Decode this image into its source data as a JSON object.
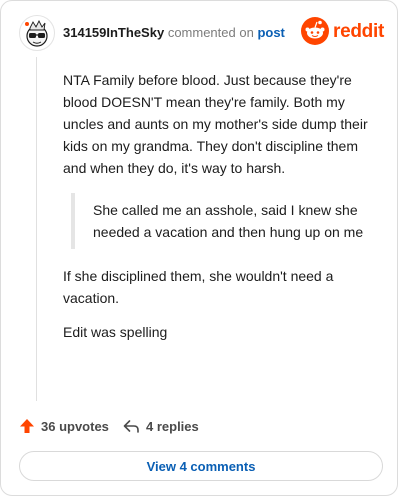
{
  "comment": {
    "username": "314159InTheSky",
    "action_text": "commented on",
    "target_link": "post",
    "paragraphs_before_quote": [
      "NTA Family before blood. Just because they're blood DOESN'T mean they're family. Both my uncles and aunts on my mother's side dump their kids on my grandma. They don't discipline them and when they do, it's way to harsh."
    ],
    "quote": "She called me an asshole, said I knew she needed a vacation and then hung up on me",
    "paragraphs_after_quote": [
      "If she disciplined them, she wouldn't need a vacation.",
      "Edit was spelling"
    ]
  },
  "brand": {
    "name": "reddit",
    "color": "#ff4500"
  },
  "actions": {
    "upvotes_label": "36 upvotes",
    "replies_label": "4 replies"
  },
  "footer": {
    "view_comments_label": "View 4 comments"
  },
  "icons": {
    "avatar": "snoo-avatar-icon",
    "logo": "reddit-logo-icon",
    "upvote": "upvote-arrow-icon",
    "reply": "reply-arrow-icon"
  }
}
